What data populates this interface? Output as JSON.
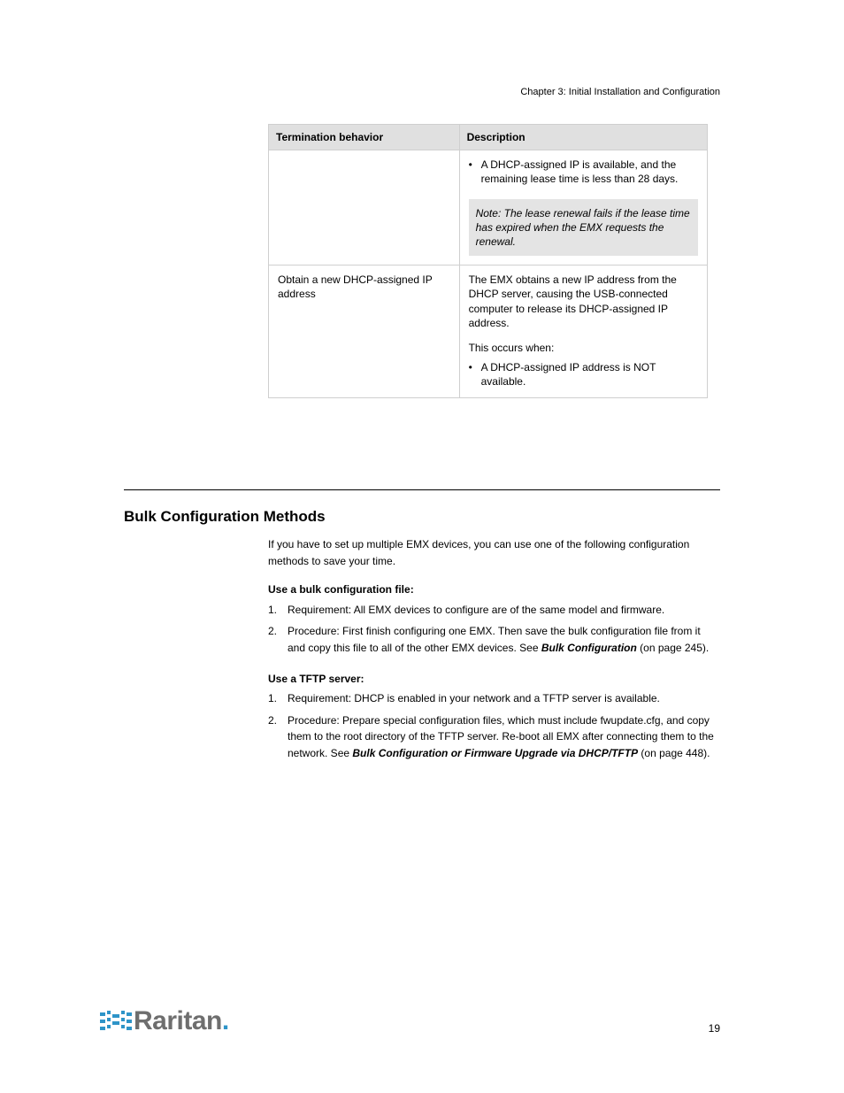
{
  "header": {
    "chapter": "Chapter 3: Initial Installation and Configuration"
  },
  "table": {
    "headers": {
      "c1": "Termination behavior",
      "c2": "Description"
    },
    "row1": {
      "c1": "",
      "b1": "A DHCP-assigned IP is available, and the remaining lease time is less than 28 days.",
      "note": "Note: The lease renewal fails if the lease time has expired when the EMX requests the renewal."
    },
    "row2": {
      "c1": "Obtain a new DHCP-assigned IP address",
      "p1": "The EMX obtains a new IP address from the DHCP server, causing the USB-connected computer to release its DHCP-assigned IP address.",
      "p2": "This occurs when:",
      "b1": "A DHCP-assigned IP address is NOT available."
    }
  },
  "section": {
    "title": "Bulk Configuration Methods",
    "p1a": "If you have to set up multiple EMX devices, you can use one of the following configuration methods to save your time.",
    "lbl1": "Use a bulk configuration file:",
    "n1": "Requirement: All EMX devices to configure are of the same model and firmware.",
    "n2a": "Procedure: First finish configuring one EMX. Then save the bulk configuration file from it and copy this file to all of the other EMX devices. See ",
    "n2link": "Bulk Configuration",
    "n2b": " (on page 245).",
    "lbl2": "Use a TFTP server:",
    "n3": "Requirement: DHCP is enabled in your network and a TFTP server is available.",
    "n4a": "Procedure: Prepare special configuration files, which must include fwupdate.cfg, and copy them to the root directory of the TFTP server. Re-boot all EMX after connecting them to the network. See ",
    "n4link": "Bulk Configuration or Firmware Upgrade via DHCP/TFTP",
    "n4b": " (on page 448)."
  },
  "footer": {
    "brand": "Raritan",
    "page": "19"
  }
}
